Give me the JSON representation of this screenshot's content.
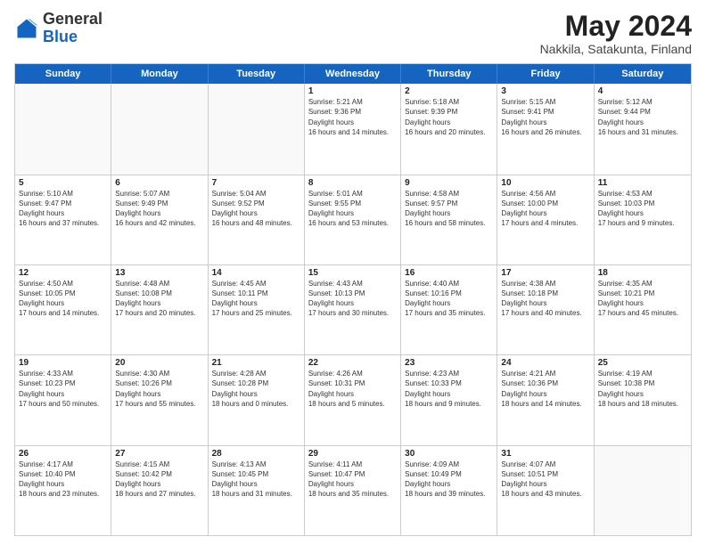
{
  "header": {
    "logo": {
      "general": "General",
      "blue": "Blue"
    },
    "title": "May 2024",
    "location": "Nakkila, Satakunta, Finland"
  },
  "weekdays": [
    "Sunday",
    "Monday",
    "Tuesday",
    "Wednesday",
    "Thursday",
    "Friday",
    "Saturday"
  ],
  "weeks": [
    [
      {
        "day": "",
        "empty": true
      },
      {
        "day": "",
        "empty": true
      },
      {
        "day": "",
        "empty": true
      },
      {
        "day": "1",
        "sunrise": "5:21 AM",
        "sunset": "9:36 PM",
        "daylight": "16 hours and 14 minutes."
      },
      {
        "day": "2",
        "sunrise": "5:18 AM",
        "sunset": "9:39 PM",
        "daylight": "16 hours and 20 minutes."
      },
      {
        "day": "3",
        "sunrise": "5:15 AM",
        "sunset": "9:41 PM",
        "daylight": "16 hours and 26 minutes."
      },
      {
        "day": "4",
        "sunrise": "5:12 AM",
        "sunset": "9:44 PM",
        "daylight": "16 hours and 31 minutes."
      }
    ],
    [
      {
        "day": "5",
        "sunrise": "5:10 AM",
        "sunset": "9:47 PM",
        "daylight": "16 hours and 37 minutes."
      },
      {
        "day": "6",
        "sunrise": "5:07 AM",
        "sunset": "9:49 PM",
        "daylight": "16 hours and 42 minutes."
      },
      {
        "day": "7",
        "sunrise": "5:04 AM",
        "sunset": "9:52 PM",
        "daylight": "16 hours and 48 minutes."
      },
      {
        "day": "8",
        "sunrise": "5:01 AM",
        "sunset": "9:55 PM",
        "daylight": "16 hours and 53 minutes."
      },
      {
        "day": "9",
        "sunrise": "4:58 AM",
        "sunset": "9:57 PM",
        "daylight": "16 hours and 58 minutes."
      },
      {
        "day": "10",
        "sunrise": "4:56 AM",
        "sunset": "10:00 PM",
        "daylight": "17 hours and 4 minutes."
      },
      {
        "day": "11",
        "sunrise": "4:53 AM",
        "sunset": "10:03 PM",
        "daylight": "17 hours and 9 minutes."
      }
    ],
    [
      {
        "day": "12",
        "sunrise": "4:50 AM",
        "sunset": "10:05 PM",
        "daylight": "17 hours and 14 minutes."
      },
      {
        "day": "13",
        "sunrise": "4:48 AM",
        "sunset": "10:08 PM",
        "daylight": "17 hours and 20 minutes."
      },
      {
        "day": "14",
        "sunrise": "4:45 AM",
        "sunset": "10:11 PM",
        "daylight": "17 hours and 25 minutes."
      },
      {
        "day": "15",
        "sunrise": "4:43 AM",
        "sunset": "10:13 PM",
        "daylight": "17 hours and 30 minutes."
      },
      {
        "day": "16",
        "sunrise": "4:40 AM",
        "sunset": "10:16 PM",
        "daylight": "17 hours and 35 minutes."
      },
      {
        "day": "17",
        "sunrise": "4:38 AM",
        "sunset": "10:18 PM",
        "daylight": "17 hours and 40 minutes."
      },
      {
        "day": "18",
        "sunrise": "4:35 AM",
        "sunset": "10:21 PM",
        "daylight": "17 hours and 45 minutes."
      }
    ],
    [
      {
        "day": "19",
        "sunrise": "4:33 AM",
        "sunset": "10:23 PM",
        "daylight": "17 hours and 50 minutes."
      },
      {
        "day": "20",
        "sunrise": "4:30 AM",
        "sunset": "10:26 PM",
        "daylight": "17 hours and 55 minutes."
      },
      {
        "day": "21",
        "sunrise": "4:28 AM",
        "sunset": "10:28 PM",
        "daylight": "18 hours and 0 minutes."
      },
      {
        "day": "22",
        "sunrise": "4:26 AM",
        "sunset": "10:31 PM",
        "daylight": "18 hours and 5 minutes."
      },
      {
        "day": "23",
        "sunrise": "4:23 AM",
        "sunset": "10:33 PM",
        "daylight": "18 hours and 9 minutes."
      },
      {
        "day": "24",
        "sunrise": "4:21 AM",
        "sunset": "10:36 PM",
        "daylight": "18 hours and 14 minutes."
      },
      {
        "day": "25",
        "sunrise": "4:19 AM",
        "sunset": "10:38 PM",
        "daylight": "18 hours and 18 minutes."
      }
    ],
    [
      {
        "day": "26",
        "sunrise": "4:17 AM",
        "sunset": "10:40 PM",
        "daylight": "18 hours and 23 minutes."
      },
      {
        "day": "27",
        "sunrise": "4:15 AM",
        "sunset": "10:42 PM",
        "daylight": "18 hours and 27 minutes."
      },
      {
        "day": "28",
        "sunrise": "4:13 AM",
        "sunset": "10:45 PM",
        "daylight": "18 hours and 31 minutes."
      },
      {
        "day": "29",
        "sunrise": "4:11 AM",
        "sunset": "10:47 PM",
        "daylight": "18 hours and 35 minutes."
      },
      {
        "day": "30",
        "sunrise": "4:09 AM",
        "sunset": "10:49 PM",
        "daylight": "18 hours and 39 minutes."
      },
      {
        "day": "31",
        "sunrise": "4:07 AM",
        "sunset": "10:51 PM",
        "daylight": "18 hours and 43 minutes."
      },
      {
        "day": "",
        "empty": true
      }
    ]
  ]
}
